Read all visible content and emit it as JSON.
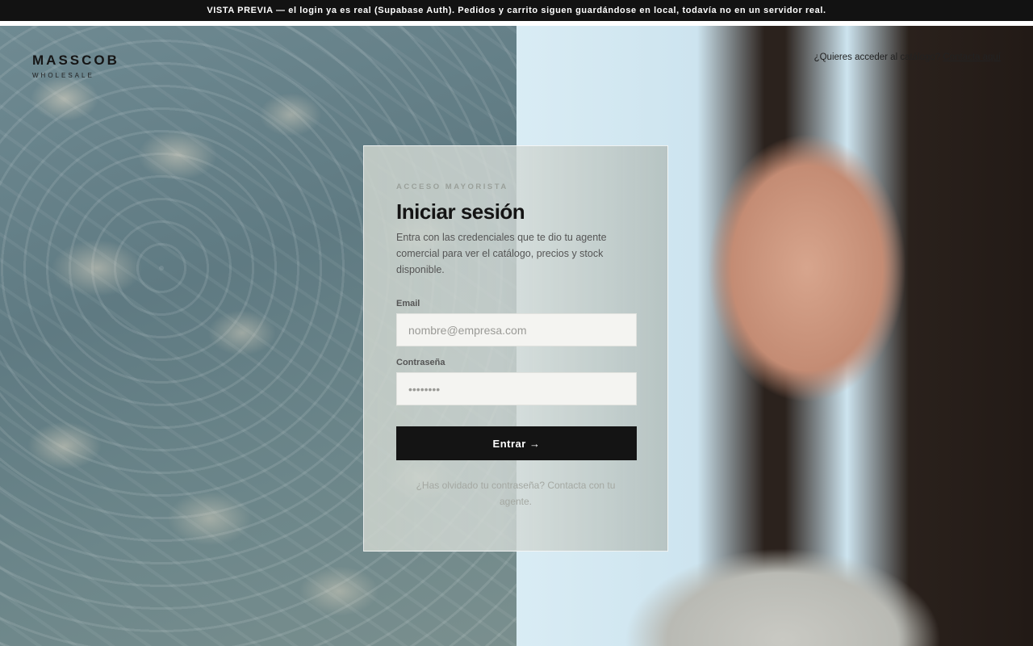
{
  "banner": {
    "text": "VISTA PREVIA — el login ya es real (Supabase Auth). Pedidos y carrito siguen guardándose en local, todavía no en un servidor real."
  },
  "brand": {
    "name": "MASSCOB",
    "subtitle": "WHOLESALE"
  },
  "topright": {
    "text": "¿Quieres acceder al catálogo? ",
    "link": "Contacta aquí"
  },
  "login": {
    "eyebrow": "ACCESO MAYORISTA",
    "title": "Iniciar sesión",
    "description": "Entra con las credenciales que te dio tu agente comercial para ver el catálogo, precios y stock disponible.",
    "email_label": "Email",
    "email_placeholder": "nombre@empresa.com",
    "password_label": "Contraseña",
    "password_placeholder": "••••••••",
    "submit_label": "Entrar →",
    "forgot_text": "¿Has olvidado tu contraseña? Contacta con tu agente."
  }
}
